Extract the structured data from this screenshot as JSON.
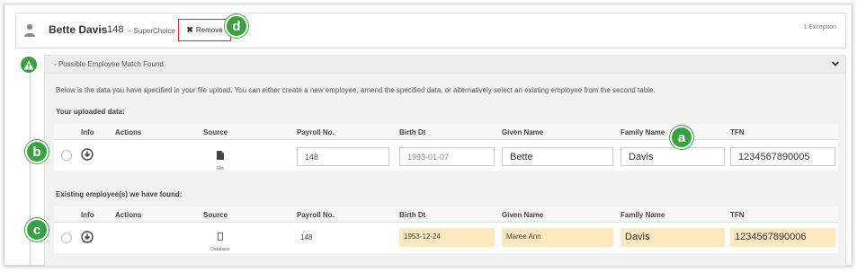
{
  "employee": {
    "name": "Bette Davis",
    "payroll_suffix": "– 148",
    "fund": "– SuperChoice",
    "remove_label": "Remove",
    "exception_count": "1 Exception"
  },
  "match": {
    "title": "- Possible Employee Match Found.",
    "intro": "Below is the data you have specified in your file upload. You can either create a new employee, amend the specified data, or alternatively select an existing employee from the second table.",
    "uploaded_heading": "Your uploaded data:",
    "existing_heading": "Existing employee(s) we have found:"
  },
  "columns": {
    "info": "Info",
    "actions": "Actions",
    "source": "Source",
    "payroll": "Payroll No.",
    "birth": "Birth Dt",
    "given": "Given Name",
    "family": "Family Name",
    "tfn": "TFN"
  },
  "uploaded_row": {
    "source_label": "File",
    "payroll": "148",
    "birth": "1993-01-07",
    "given": "Bette",
    "family": "Davis",
    "tfn": "1234567890005"
  },
  "existing_row": {
    "source_label": "Database",
    "payroll": "148",
    "birth": "1953-12-24",
    "given": "Maree Ann",
    "family": "Davis",
    "tfn": "1234567890006"
  },
  "annotations": {
    "a": "a",
    "b": "b",
    "c": "c",
    "d": "d"
  },
  "colors": {
    "accent_green": "#3aa041",
    "remove_border": "#d9302c",
    "mismatch_highlight": "#fde8bf"
  },
  "icons": {
    "person": "person-icon",
    "remove": "close-icon",
    "warning": "warning-icon",
    "collapse": "chevron-down-icon",
    "info": "download-circle-icon",
    "file": "file-icon",
    "database": "database-icon"
  }
}
